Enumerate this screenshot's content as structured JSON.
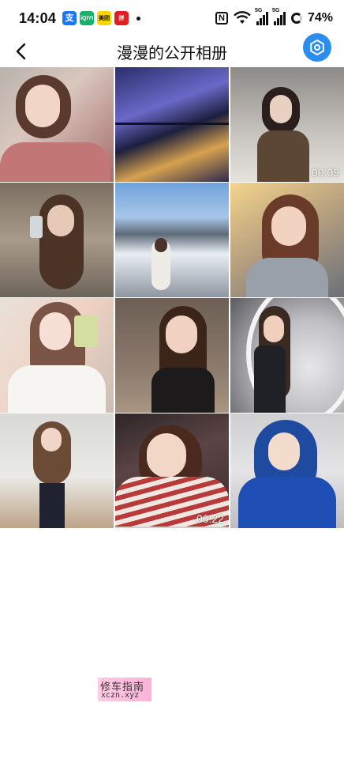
{
  "status_bar": {
    "time": "14:04",
    "apps": [
      {
        "name": "alipay",
        "label": "支"
      },
      {
        "name": "iqiyi",
        "label": "iQIYI"
      },
      {
        "name": "meituan",
        "label": "美团"
      },
      {
        "name": "pinduoduo",
        "label": "拼"
      }
    ],
    "network": [
      "5G",
      "5G"
    ],
    "battery": "74%"
  },
  "header": {
    "title": "漫漫的公开相册"
  },
  "photos": [
    {
      "duration": ""
    },
    {
      "duration": ""
    },
    {
      "duration": "00:09"
    },
    {
      "duration": ""
    },
    {
      "duration": ""
    },
    {
      "duration": ""
    },
    {
      "duration": ""
    },
    {
      "duration": ""
    },
    {
      "duration": ""
    },
    {
      "duration": ""
    },
    {
      "duration": "00:22"
    },
    {
      "duration": ""
    }
  ],
  "watermark": {
    "line1": "修车指南",
    "line2": "xczn.xyz"
  },
  "colors": {
    "accent": "#2a8df0"
  }
}
